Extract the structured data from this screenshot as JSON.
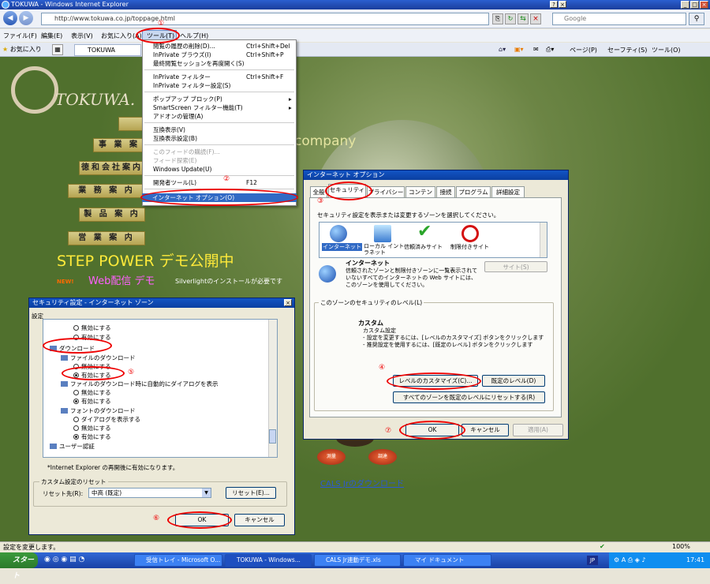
{
  "window": {
    "title": "TOKUWA - Windows Internet Explorer"
  },
  "address": {
    "url": "http://www.tokuwa.co.jp/toppage.html",
    "search_placeholder": "Google"
  },
  "menubar": [
    "ファイル(F)",
    "編集(E)",
    "表示(V)",
    "お気に入り(A)",
    "ツール(T)",
    "ヘルプ(H)"
  ],
  "favbar": {
    "favorites": "お気に入り",
    "tab": "TOKUWA",
    "tools": [
      "ページ(P)",
      "セーフティ(S)",
      "ツール(O)"
    ]
  },
  "tools_menu": {
    "items": [
      {
        "label": "閲覧の履歴の削除(D)...",
        "shortcut": "Ctrl+Shift+Del"
      },
      {
        "label": "InPrivate ブラウズ(I)",
        "shortcut": "Ctrl+Shift+P"
      },
      {
        "label": "最終閲覧セッションを再度開く(S)",
        "shortcut": ""
      },
      {
        "label": "InPrivate フィルター",
        "shortcut": "Ctrl+Shift+F"
      },
      {
        "label": "InPrivate フィルター設定(S)",
        "shortcut": ""
      },
      {
        "label": "ポップアップ ブロック(P)",
        "shortcut": ""
      },
      {
        "label": "SmartScreen フィルター機能(T)",
        "shortcut": ""
      },
      {
        "label": "アドオンの管理(A)",
        "shortcut": ""
      },
      {
        "label": "互換表示(V)",
        "shortcut": ""
      },
      {
        "label": "互換表示設定(B)",
        "shortcut": ""
      },
      {
        "label": "このフィードの購読(F)...",
        "shortcut": ""
      },
      {
        "label": "フィード探索(E)",
        "shortcut": ""
      },
      {
        "label": "Windows Update(U)",
        "shortcut": ""
      },
      {
        "label": "開発者ツール(L)",
        "shortcut": "F12"
      },
      {
        "label": "インターネット オプション(O)",
        "shortcut": ""
      }
    ]
  },
  "page": {
    "logo": "TOKUWA.",
    "company_text": "company",
    "nav": [
      "事 業 案",
      "徳和会社案内",
      "業 務 案 内",
      "製 品 案 内",
      "営 業 案 内"
    ],
    "step_power": "STEP POWER デモ公開中",
    "new_badge": "NEW!",
    "web_demo": "Web配信 デモ",
    "silverlight_note": "Silverlightのインストールが必要です",
    "cals_download": "CALS Jrのダウンロード",
    "red_buttons": [
      "測量",
      "調達"
    ]
  },
  "inet_options": {
    "title": "インターネット オプション",
    "tabs": [
      "全般",
      "セキュリティ",
      "プライバシー",
      "コンテンツ",
      "接続",
      "プログラム",
      "詳細設定"
    ],
    "zone_prompt": "セキュリティ設定を表示または変更するゾーンを選択してください。",
    "zones": [
      "インターネット",
      "ローカル イントラネット",
      "信頼済みサイト",
      "制限付きサイト"
    ],
    "zone_heading": "インターネット",
    "zone_desc": "信頼されたゾーンと制限付きゾーンに一覧表示されていないすべてのインターネットの Web サイトには、このゾーンを使用してください。",
    "sites_button": "サイト(S)",
    "level_group": "このゾーンのセキュリティのレベル(L)",
    "custom_heading": "カスタム",
    "custom_lines": [
      "カスタム設定",
      "- 設定を変更するには、[レベルのカスタマイズ] ボタンをクリックします",
      "- 推奨設定を使用するには、[既定のレベル] ボタンをクリックします"
    ],
    "customize_button": "レベルのカスタマイズ(C)...",
    "default_button": "既定のレベル(D)",
    "reset_all_button": "すべてのゾーンを既定のレベルにリセットする(R)",
    "ok": "OK",
    "cancel": "キャンセル",
    "apply": "適用(A)"
  },
  "sec_settings": {
    "title": "セキュリティ設定 - インターネット ゾーン",
    "settings_label": "設定",
    "tree": [
      {
        "type": "radio",
        "label": "無効にする",
        "checked": false,
        "indent": 2
      },
      {
        "type": "radio",
        "label": "有効にする",
        "checked": false,
        "indent": 2
      },
      {
        "type": "category",
        "label": "ダウンロード",
        "indent": 0
      },
      {
        "type": "setting",
        "label": "ファイルのダウンロード",
        "indent": 1
      },
      {
        "type": "radio",
        "label": "無効にする",
        "checked": false,
        "indent": 2
      },
      {
        "type": "radio",
        "label": "有効にする",
        "checked": true,
        "indent": 2
      },
      {
        "type": "setting",
        "label": "ファイルのダウンロード時に自動的にダイアログを表示",
        "indent": 1
      },
      {
        "type": "radio",
        "label": "無効にする",
        "checked": false,
        "indent": 2
      },
      {
        "type": "radio",
        "label": "有効にする",
        "checked": true,
        "indent": 2
      },
      {
        "type": "setting",
        "label": "フォントのダウンロード",
        "indent": 1
      },
      {
        "type": "radio",
        "label": "ダイアログを表示する",
        "checked": false,
        "indent": 2
      },
      {
        "type": "radio",
        "label": "無効にする",
        "checked": false,
        "indent": 2
      },
      {
        "type": "radio",
        "label": "有効にする",
        "checked": true,
        "indent": 2
      },
      {
        "type": "category",
        "label": "ユーザー認証",
        "indent": 0
      }
    ],
    "note": "*Internet Explorer の再開後に有効になります。",
    "reset_group": "カスタム設定のリセット",
    "reset_to_label": "リセット先(R):",
    "reset_value": "中高 (既定)",
    "reset_button": "リセット(E)...",
    "ok": "OK",
    "cancel": "キャンセル"
  },
  "annotations": [
    "①",
    "②",
    "③",
    "④",
    "⑤",
    "⑥",
    "⑦"
  ],
  "status": {
    "text": "設定を変更します。",
    "zoom": "100%"
  },
  "taskbar": {
    "start": "スタート",
    "tasks": [
      "受信トレイ - Microsoft O...",
      "TOKUWA - Windows...",
      "CALS Jr連動デモ.xls",
      "マイ ドキュメント"
    ],
    "lang": "JP",
    "time": "17:41"
  }
}
